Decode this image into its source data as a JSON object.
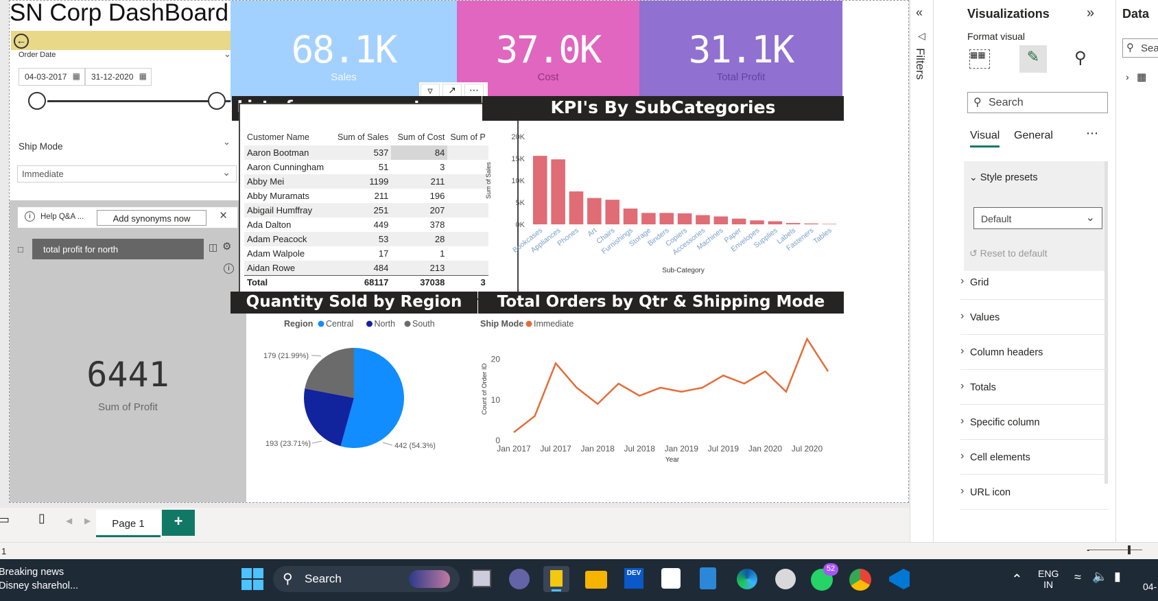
{
  "dashboard": {
    "title": "SN Corp DashBoard",
    "order_date_label": "Order Date",
    "date_start": "04-03-2017",
    "date_end": "31-12-2020",
    "ship_mode_label": "Ship Mode",
    "ship_mode_value": "Immediate",
    "qa_help": "Help Q&A ...",
    "qa_synonyms": "Add synonyms now",
    "qa_query": "total profit for north",
    "profit_value": "6441",
    "profit_label": "Sum of Profit"
  },
  "cards": [
    {
      "value": "68.1K",
      "label": "Sales",
      "color": "#a3d1ff"
    },
    {
      "value": "37.0K",
      "label": "Cost",
      "color": "#e066c0"
    },
    {
      "value": "31.1K",
      "label": "Total  Profit",
      "color": "#9070d0"
    }
  ],
  "customers_table": {
    "title": "List of company customers",
    "headers": [
      "Customer Name",
      "Sum of Sales",
      "Sum of Cost",
      "Sum of P"
    ],
    "rows": [
      [
        "Aaron Bootman",
        "537",
        "84",
        ""
      ],
      [
        "Aaron Cunningham",
        "51",
        "3",
        ""
      ],
      [
        "Abby Mei",
        "1199",
        "211",
        ""
      ],
      [
        "Abby Muramats",
        "211",
        "196",
        ""
      ],
      [
        "Abigail Humffray",
        "251",
        "207",
        ""
      ],
      [
        "Ada Dalton",
        "449",
        "378",
        ""
      ],
      [
        "Adam Peacock",
        "53",
        "28",
        ""
      ],
      [
        "Adam Walpole",
        "17",
        "1",
        ""
      ],
      [
        "Aidan Rowe",
        "484",
        "213",
        ""
      ]
    ],
    "total": [
      "Total",
      "68117",
      "37038",
      "3"
    ]
  },
  "bar_chart": {
    "title": "KPI's By SubCategories",
    "xlabel": "Sub-Category",
    "ylabel": "Sum of Sales",
    "yticks": [
      "0K",
      "5K",
      "10K",
      "15K",
      "20K"
    ]
  },
  "pie_chart": {
    "title": "Quantity Sold by Region",
    "legend_title": "Region",
    "labels": [
      "179 (21.99%)",
      "193 (23.71%)",
      "442 (54.3%)"
    ]
  },
  "line_chart": {
    "title": "Total Orders by Qtr & Shipping Mode",
    "legend_title": "Ship Mode",
    "xlabel": "Year",
    "ylabel": "Count of Order ID",
    "yticks": [
      "0",
      "10",
      "20"
    ],
    "xticks": [
      "Jan 2017",
      "Jul 2017",
      "Jan 2018",
      "Jul 2018",
      "Jan 2019",
      "Jul 2019",
      "Jan 2020",
      "Jul 2020"
    ]
  },
  "chart_data": [
    {
      "type": "bar",
      "title": "KPI's By SubCategories",
      "xlabel": "Sub-Category",
      "ylabel": "Sum of Sales",
      "ylim": [
        0,
        20000
      ],
      "categories": [
        "Bookcases",
        "Appliances",
        "Phones",
        "Art",
        "Chairs",
        "Furnishings",
        "Storage",
        "Binders",
        "Copiers",
        "Accessories",
        "Machines",
        "Paper",
        "Envelopes",
        "Supplies",
        "Labels",
        "Fasteners",
        "Tables"
      ],
      "values": [
        15600,
        14800,
        7500,
        6000,
        5600,
        3600,
        2600,
        2600,
        2500,
        2100,
        1800,
        1300,
        900,
        700,
        300,
        200,
        100
      ],
      "color": "#e06c75"
    },
    {
      "type": "pie",
      "title": "Quantity Sold by Region",
      "categories": [
        "Central",
        "North",
        "South"
      ],
      "values": [
        442,
        193,
        179
      ],
      "colors": [
        "#118dff",
        "#12239e",
        "#6b6b6b"
      ]
    },
    {
      "type": "line",
      "title": "Total Orders by Qtr & Shipping Mode",
      "xlabel": "Year",
      "ylabel": "Count of Order ID",
      "ylim": [
        0,
        25
      ],
      "x": [
        "Q1 2017",
        "Q2 2017",
        "Q3 2017",
        "Q4 2017",
        "Q1 2018",
        "Q2 2018",
        "Q3 2018",
        "Q4 2018",
        "Q1 2019",
        "Q2 2019",
        "Q3 2019",
        "Q4 2019",
        "Q1 2020",
        "Q2 2020",
        "Q3 2020",
        "Q4 2020"
      ],
      "series": [
        {
          "name": "Immediate",
          "values": [
            2,
            6,
            19,
            13,
            9,
            14,
            11,
            13,
            12,
            13,
            16,
            14,
            17,
            12,
            25,
            17
          ],
          "color": "#e66c37"
        }
      ]
    }
  ],
  "vis_panel": {
    "title": "Visualizations",
    "format_visual": "Format visual",
    "search_placeholder": "Search",
    "tab_visual": "Visual",
    "tab_general": "General",
    "style_presets": "Style presets",
    "preset_value": "Default",
    "reset": "Reset to default",
    "sections": [
      "Grid",
      "Values",
      "Column headers",
      "Totals",
      "Specific column",
      "Cell elements",
      "URL icon"
    ]
  },
  "filters_label": "Filters",
  "data_panel": {
    "title": "Data",
    "search": "Sea"
  },
  "pages": {
    "tab": "Page 1",
    "add": "+"
  },
  "status": {
    "page_num": "1"
  },
  "taskbar": {
    "news_line1": "Breaking news",
    "news_line2": "Disney sharehol...",
    "search": "Search",
    "lang1": "ENG",
    "lang2": "IN",
    "badge": "52",
    "clock": "04-"
  }
}
